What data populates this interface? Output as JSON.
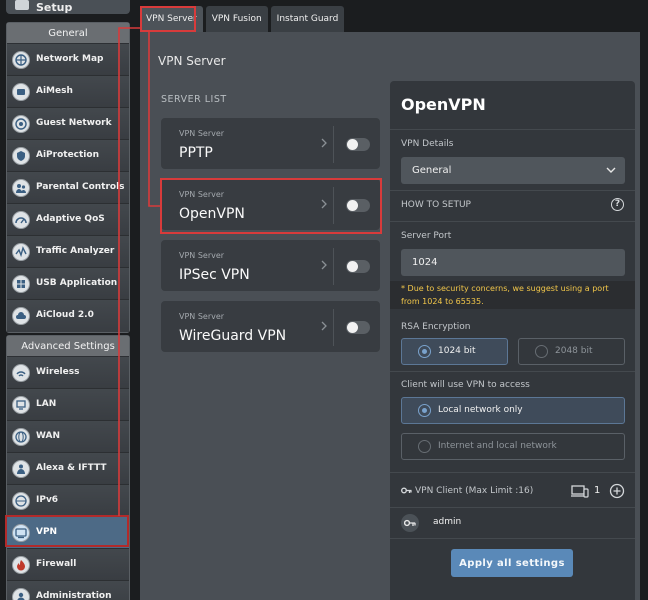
{
  "sidebar": {
    "setup_label": "Setup",
    "general_header": "General",
    "general_items": [
      {
        "label": "Network Map",
        "icon": "network-map-icon"
      },
      {
        "label": "AiMesh",
        "icon": "aimesh-icon"
      },
      {
        "label": "Guest Network",
        "icon": "guest-network-icon"
      },
      {
        "label": "AiProtection",
        "icon": "aiprotection-icon"
      },
      {
        "label": "Parental Controls",
        "icon": "parental-controls-icon"
      },
      {
        "label": "Adaptive QoS",
        "icon": "adaptive-qos-icon"
      },
      {
        "label": "Traffic Analyzer",
        "icon": "traffic-analyzer-icon"
      },
      {
        "label": "USB Application",
        "icon": "usb-application-icon"
      },
      {
        "label": "AiCloud 2.0",
        "icon": "aicloud-icon"
      }
    ],
    "advanced_header": "Advanced Settings",
    "advanced_items": [
      {
        "label": "Wireless",
        "icon": "wireless-icon"
      },
      {
        "label": "LAN",
        "icon": "lan-icon"
      },
      {
        "label": "WAN",
        "icon": "wan-icon"
      },
      {
        "label": "Alexa & IFTTT",
        "icon": "alexa-icon"
      },
      {
        "label": "IPv6",
        "icon": "ipv6-icon"
      },
      {
        "label": "VPN",
        "icon": "vpn-icon",
        "active": true
      },
      {
        "label": "Firewall",
        "icon": "firewall-icon"
      },
      {
        "label": "Administration",
        "icon": "administration-icon"
      }
    ]
  },
  "tabs": [
    {
      "label": "VPN Server",
      "active": true
    },
    {
      "label": "VPN Fusion"
    },
    {
      "label": "Instant Guard"
    }
  ],
  "main": {
    "title": "VPN Server",
    "server_list_label": "SERVER LIST",
    "servers": [
      {
        "sub": "VPN Server",
        "name": "PPTP",
        "enabled": false
      },
      {
        "sub": "VPN Server",
        "name": "OpenVPN",
        "enabled": false,
        "selected": true
      },
      {
        "sub": "VPN Server",
        "name": "IPSec VPN",
        "enabled": false
      },
      {
        "sub": "VPN Server",
        "name": "WireGuard VPN",
        "enabled": false
      }
    ]
  },
  "panel": {
    "title": "OpenVPN",
    "vpn_details_label": "VPN Details",
    "vpn_details_value": "General",
    "how_to_setup": "HOW TO SETUP",
    "help_icon": "?",
    "server_port_label": "Server Port",
    "server_port_value": "1024",
    "port_warning": "* Due to security concerns, we suggest using a port from 1024 to 65535.",
    "rsa_label": "RSA Encryption",
    "rsa_options": [
      {
        "label": "1024 bit",
        "selected": true
      },
      {
        "label": "2048 bit",
        "selected": false
      }
    ],
    "client_access_label": "Client will use VPN to access",
    "client_access_options": [
      {
        "label": "Local network only",
        "selected": true
      },
      {
        "label": "Internet and local network",
        "selected": false
      }
    ],
    "vpn_client_label": "VPN Client (Max Limit :16)",
    "vpn_client_count": "1",
    "users": [
      "admin"
    ],
    "apply_label": "Apply all settings"
  },
  "colors": {
    "accent": "#5a89b8",
    "warning_text": "#f1c64a",
    "highlight": "#d83b3b"
  }
}
